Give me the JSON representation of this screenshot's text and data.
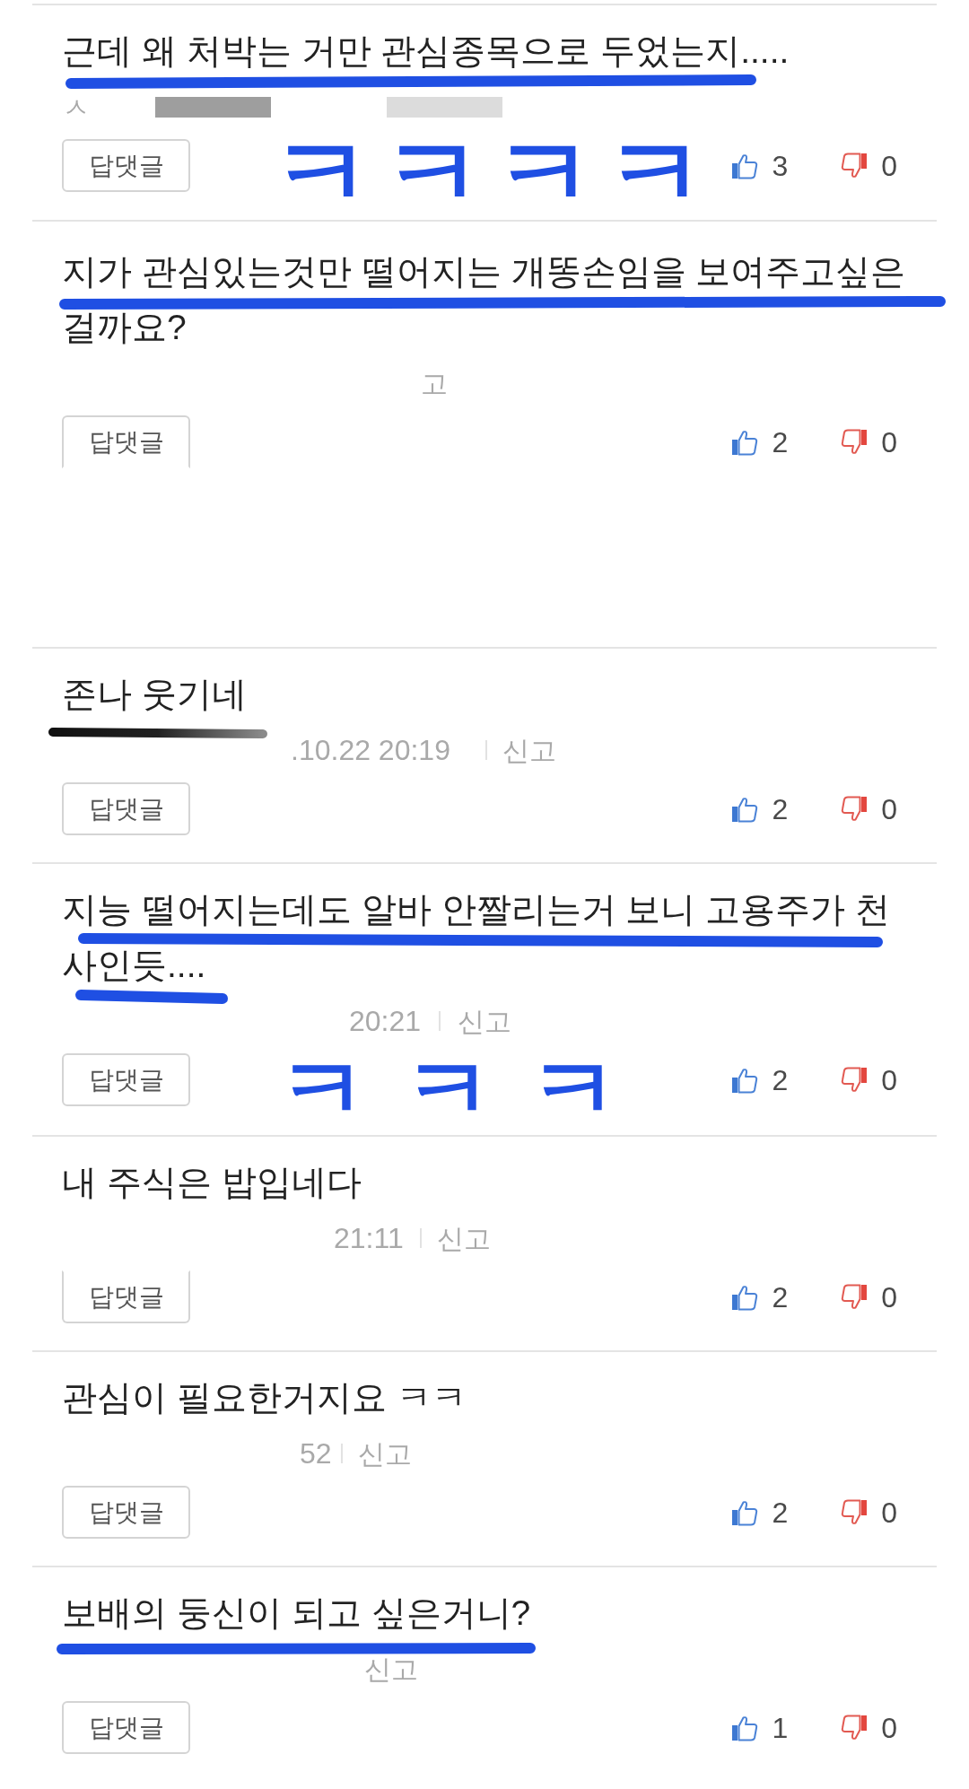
{
  "comments": [
    {
      "lines": [
        "근데 왜 처박는 거만 관심종목으로 두었는지....."
      ],
      "meta": [
        {
          "kind": "author",
          "text": "ㅅ"
        },
        {
          "kind": "redaction",
          "color": "#9e9e9e"
        },
        {
          "kind": "redaction",
          "color": "#dcdcdc"
        }
      ],
      "reply": "답댓글",
      "button_top_cut": false,
      "button_bottom_cut": false,
      "likes": "3",
      "dislikes": "0",
      "annotations": [
        {
          "kind": "underline"
        },
        {
          "kind": "handwriting",
          "text": "ㅋㅋㅋㅋ"
        }
      ]
    },
    {
      "lines": [
        "지가 관심있는것만 떨어지는 개똥손임을 보여주고싶은",
        "걸까요?"
      ],
      "meta": [
        {
          "kind": "report",
          "text": "고"
        }
      ],
      "reply": "답댓글",
      "button_top_cut": false,
      "button_bottom_cut": true,
      "likes": "2",
      "dislikes": "0",
      "annotations": [
        {
          "kind": "underline"
        }
      ]
    },
    {
      "lines": [
        "존나 웃기네"
      ],
      "meta": [
        {
          "kind": "time",
          "text": ".10.22 20:19"
        },
        {
          "kind": "separator"
        },
        {
          "kind": "report",
          "text": "신고"
        }
      ],
      "reply": "답댓글",
      "button_top_cut": false,
      "button_bottom_cut": false,
      "likes": "2",
      "dislikes": "0",
      "annotations": [
        {
          "kind": "scrawl"
        }
      ]
    },
    {
      "lines": [
        "지능 떨어지는데도 알바 안짤리는거 보니 고용주가 천",
        "사인듯...."
      ],
      "meta": [
        {
          "kind": "time",
          "text": "20:21"
        },
        {
          "kind": "separator"
        },
        {
          "kind": "report",
          "text": "신고"
        }
      ],
      "reply": "답댓글",
      "button_top_cut": false,
      "button_bottom_cut": false,
      "likes": "2",
      "dislikes": "0",
      "annotations": [
        {
          "kind": "underline"
        },
        {
          "kind": "underline"
        },
        {
          "kind": "handwriting",
          "text": "ㅋㅋㅋ"
        }
      ]
    },
    {
      "lines": [
        "내 주식은 밥입네다"
      ],
      "meta": [
        {
          "kind": "time",
          "text": "21:11"
        },
        {
          "kind": "separator"
        },
        {
          "kind": "report",
          "text": "신고"
        }
      ],
      "reply": "답댓글",
      "button_top_cut": true,
      "button_bottom_cut": false,
      "likes": "2",
      "dislikes": "0"
    },
    {
      "lines": [
        "관심이 필요한거지요 ㅋㅋ"
      ],
      "meta": [
        {
          "kind": "time",
          "text": "52"
        },
        {
          "kind": "separator"
        },
        {
          "kind": "report",
          "text": "신고"
        }
      ],
      "reply": "답댓글",
      "button_top_cut": false,
      "button_bottom_cut": false,
      "likes": "2",
      "dislikes": "0"
    },
    {
      "lines": [
        "보배의 둥신이 되고 싶은거니?"
      ],
      "meta": [
        {
          "kind": "report",
          "text": "신고"
        }
      ],
      "reply": "답댓글",
      "button_top_cut": false,
      "button_bottom_cut": false,
      "likes": "1",
      "dislikes": "0",
      "annotations": [
        {
          "kind": "underline"
        }
      ]
    }
  ]
}
